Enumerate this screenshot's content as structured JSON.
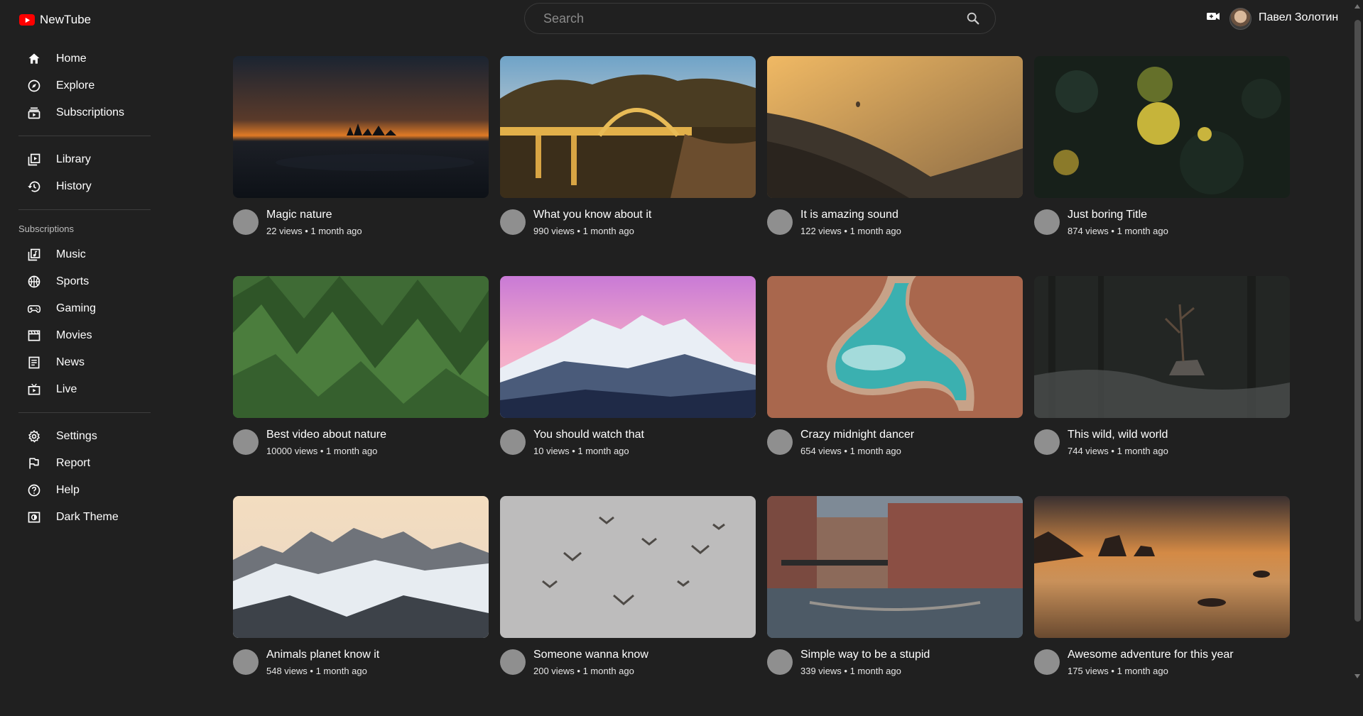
{
  "app": {
    "name": "NewTube"
  },
  "search": {
    "placeholder": "Search"
  },
  "user": {
    "name": "Павел Золотин"
  },
  "sidebar": {
    "primary": [
      {
        "label": "Home",
        "icon": "home-icon"
      },
      {
        "label": "Explore",
        "icon": "compass-icon"
      },
      {
        "label": "Subscriptions",
        "icon": "subscriptions-icon"
      }
    ],
    "secondary": [
      {
        "label": "Library",
        "icon": "library-icon"
      },
      {
        "label": "History",
        "icon": "history-icon"
      }
    ],
    "subscriptions_title": "Subscriptions",
    "subscriptions": [
      {
        "label": "Music",
        "icon": "music-icon"
      },
      {
        "label": "Sports",
        "icon": "sports-icon"
      },
      {
        "label": "Gaming",
        "icon": "gaming-icon"
      },
      {
        "label": "Movies",
        "icon": "movies-icon"
      },
      {
        "label": "News",
        "icon": "news-icon"
      },
      {
        "label": "Live",
        "icon": "live-icon"
      }
    ],
    "footer": [
      {
        "label": "Settings",
        "icon": "gear-icon"
      },
      {
        "label": "Report",
        "icon": "flag-icon"
      },
      {
        "label": "Help",
        "icon": "help-icon"
      },
      {
        "label": "Dark Theme",
        "icon": "theme-icon"
      }
    ]
  },
  "videos": [
    {
      "title": "Magic nature",
      "stats": "22 views • 1 month ago"
    },
    {
      "title": "What you know about it",
      "stats": "990 views • 1 month ago"
    },
    {
      "title": "It is amazing sound",
      "stats": "122 views • 1 month ago"
    },
    {
      "title": "Just boring Title",
      "stats": "874 views • 1 month ago"
    },
    {
      "title": "Best video about nature",
      "stats": "10000 views • 1 month ago"
    },
    {
      "title": "You should watch that",
      "stats": "10 views • 1 month ago"
    },
    {
      "title": "Crazy midnight dancer",
      "stats": "654 views • 1 month ago"
    },
    {
      "title": "This wild, wild world",
      "stats": "744 views • 1 month ago"
    },
    {
      "title": "Animals planet know it",
      "stats": "548 views • 1 month ago"
    },
    {
      "title": "Someone wanna know",
      "stats": "200 views • 1 month ago"
    },
    {
      "title": "Simple way to be a stupid",
      "stats": "339 views • 1 month ago"
    },
    {
      "title": "Awesome adventure for this year",
      "stats": "175 views • 1 month ago"
    }
  ]
}
